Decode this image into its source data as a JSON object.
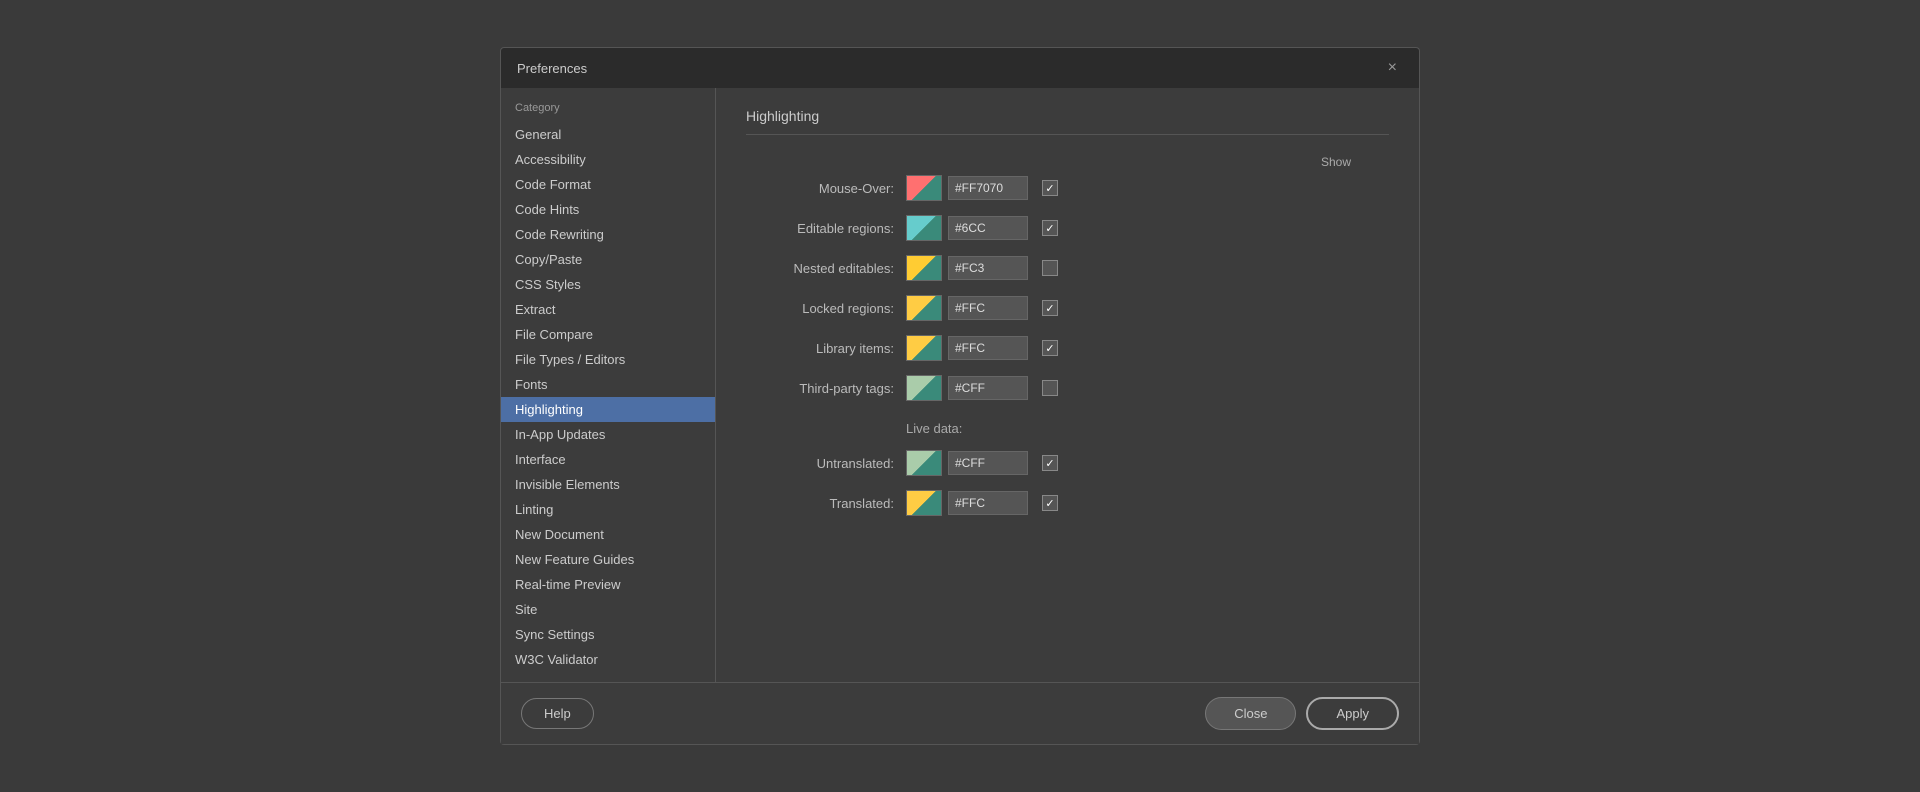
{
  "dialog": {
    "title": "Preferences",
    "close_icon": "×"
  },
  "sidebar": {
    "header": "Category",
    "items": [
      {
        "label": "General",
        "active": false
      },
      {
        "label": "Accessibility",
        "active": false
      },
      {
        "label": "Code Format",
        "active": false
      },
      {
        "label": "Code Hints",
        "active": false
      },
      {
        "label": "Code Rewriting",
        "active": false
      },
      {
        "label": "Copy/Paste",
        "active": false
      },
      {
        "label": "CSS Styles",
        "active": false
      },
      {
        "label": "Extract",
        "active": false
      },
      {
        "label": "File Compare",
        "active": false
      },
      {
        "label": "File Types / Editors",
        "active": false
      },
      {
        "label": "Fonts",
        "active": false
      },
      {
        "label": "Highlighting",
        "active": true
      },
      {
        "label": "In-App Updates",
        "active": false
      },
      {
        "label": "Interface",
        "active": false
      },
      {
        "label": "Invisible Elements",
        "active": false
      },
      {
        "label": "Linting",
        "active": false
      },
      {
        "label": "New Document",
        "active": false
      },
      {
        "label": "New Feature Guides",
        "active": false
      },
      {
        "label": "Real-time Preview",
        "active": false
      },
      {
        "label": "Site",
        "active": false
      },
      {
        "label": "Sync Settings",
        "active": false
      },
      {
        "label": "W3C Validator",
        "active": false
      }
    ]
  },
  "main": {
    "section_title": "Highlighting",
    "show_label": "Show",
    "rows": [
      {
        "label": "Mouse-Over:",
        "underline": "M",
        "value": "#FF7070",
        "checked": true,
        "swatch_class": "swatch-mouseover"
      },
      {
        "label": "Editable regions:",
        "underline": "E",
        "value": "#6CC",
        "checked": true,
        "swatch_class": "swatch-editable"
      },
      {
        "label": "Nested editables:",
        "underline": "N",
        "value": "#FC3",
        "checked": false,
        "swatch_class": "swatch-nested"
      },
      {
        "label": "Locked regions:",
        "underline": "L",
        "value": "#FFC",
        "checked": true,
        "swatch_class": "swatch-locked"
      },
      {
        "label": "Library items:",
        "underline": "i",
        "value": "#FFC",
        "checked": true,
        "swatch_class": "swatch-library"
      },
      {
        "label": "Third-party tags:",
        "underline": "T",
        "value": "#CFF",
        "checked": false,
        "swatch_class": "swatch-thirdparty"
      }
    ],
    "live_data_label": "Live data:",
    "live_data_rows": [
      {
        "label": "Untranslated:",
        "underline": "U",
        "value": "#CFF",
        "checked": true,
        "swatch_class": "swatch-untranslated"
      },
      {
        "label": "Translated:",
        "underline": "r",
        "value": "#FFC",
        "checked": true,
        "swatch_class": "swatch-translated"
      }
    ]
  },
  "footer": {
    "help_label": "Help",
    "close_label": "Close",
    "apply_label": "Apply"
  }
}
